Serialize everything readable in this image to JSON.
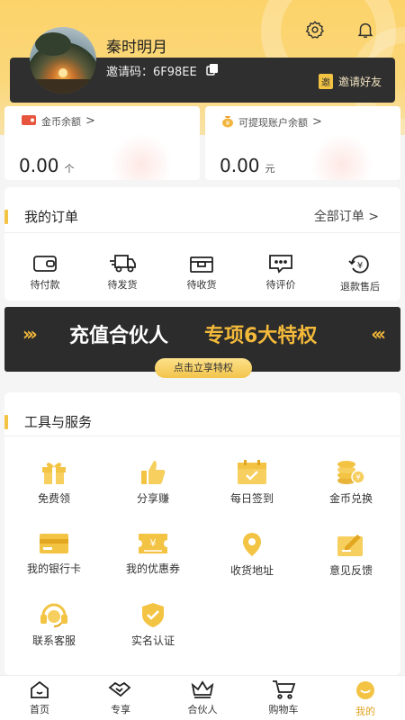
{
  "header": {
    "username": "秦时明月",
    "invite_label": "邀请码：6F98EE",
    "invite_badge": "邀",
    "invite_friend": "邀请好友",
    "settings_icon": "gear-icon",
    "bell_icon": "bell-icon"
  },
  "balances": [
    {
      "label": "金币余额",
      "arrow": ">",
      "value": "0.00",
      "unit": "个"
    },
    {
      "label": "可提现账户余额",
      "arrow": ">",
      "value": "0.00",
      "unit": "元"
    }
  ],
  "orders": {
    "title": "我的订单",
    "all_label": "全部订单 >",
    "items": [
      {
        "label": "待付款",
        "icon": "wallet-icon"
      },
      {
        "label": "待发货",
        "icon": "truck-icon"
      },
      {
        "label": "待收货",
        "icon": "box-icon"
      },
      {
        "label": "待评价",
        "icon": "comment-icon"
      },
      {
        "label": "退款售后",
        "icon": "refund-icon"
      }
    ]
  },
  "banner": {
    "left_arrows": "›››",
    "text_main": "充值合伙人",
    "text_highlight": "专项6大特权",
    "right_arrows": "‹‹‹",
    "button_label": "点击立享特权"
  },
  "tools": {
    "title": "工具与服务",
    "items": [
      {
        "label": "免费领",
        "icon": "gift-icon"
      },
      {
        "label": "分享赚",
        "icon": "thumbs-up-icon"
      },
      {
        "label": "每日签到",
        "icon": "calendar-check-icon"
      },
      {
        "label": "金币兑换",
        "icon": "coins-icon"
      },
      {
        "label": "我的银行卡",
        "icon": "bank-card-icon"
      },
      {
        "label": "我的优惠券",
        "icon": "coupon-icon"
      },
      {
        "label": "收货地址",
        "icon": "location-pin-icon"
      },
      {
        "label": "意见反馈",
        "icon": "feedback-icon"
      },
      {
        "label": "联系客服",
        "icon": "headset-icon"
      },
      {
        "label": "实名认证",
        "icon": "shield-check-icon"
      }
    ]
  },
  "tabbar": {
    "items": [
      {
        "label": "首页",
        "icon": "home-icon"
      },
      {
        "label": "专享",
        "icon": "handshake-icon"
      },
      {
        "label": "合伙人",
        "icon": "crown-icon"
      },
      {
        "label": "购物车",
        "icon": "cart-icon"
      },
      {
        "label": "我的",
        "icon": "profile-icon",
        "active": true
      }
    ]
  },
  "colors": {
    "accent": "#f3c343",
    "header_bg": "#fcd36a",
    "dark": "#2f2f2f",
    "active_tab": "#e0a420"
  }
}
